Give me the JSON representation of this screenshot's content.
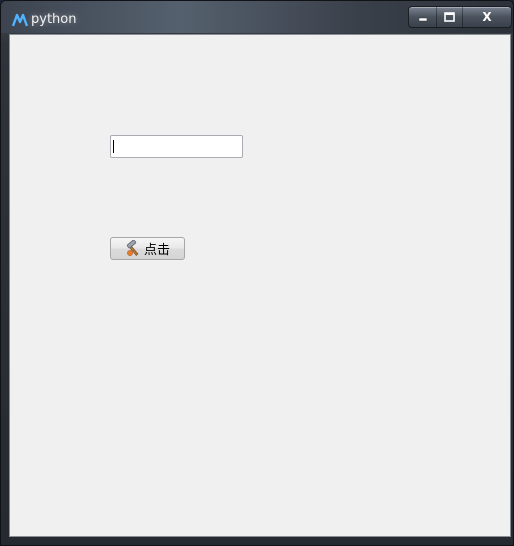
{
  "window": {
    "title": "python",
    "controls": {
      "minimize": "minimize",
      "maximize": "maximize",
      "close": "X"
    }
  },
  "form": {
    "input_value": "",
    "button_label": "点击",
    "button_icon": "hammer-icon"
  },
  "colors": {
    "client_background": "#f0f0f0",
    "titlebar": "#3d4450"
  }
}
